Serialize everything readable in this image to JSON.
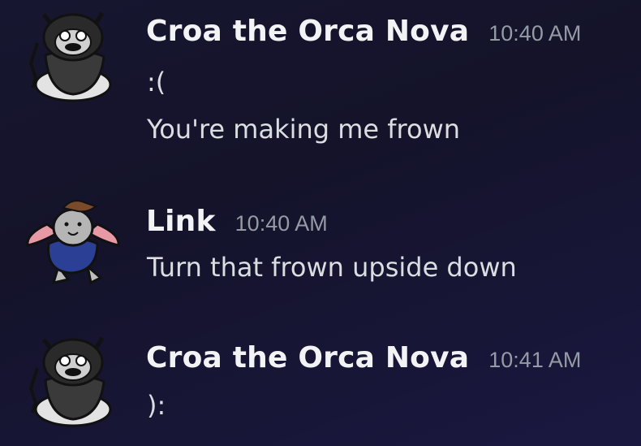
{
  "messages": [
    {
      "author": "Croa the Orca Nova",
      "time": "10:40 AM",
      "avatar_icon": "orca-avatar-icon",
      "lines": [
        ":(",
        "You're making me frown"
      ]
    },
    {
      "author": "Link",
      "time": "10:40 AM",
      "avatar_icon": "bunny-avatar-icon",
      "lines": [
        "Turn that frown upside down"
      ]
    },
    {
      "author": "Croa the Orca Nova",
      "time": "10:41 AM",
      "avatar_icon": "orca-avatar-icon",
      "lines": [
        "):"
      ]
    }
  ],
  "colors": {
    "background": "#15142d",
    "author": "#f2f3f5",
    "timestamp": "#949ba4",
    "message_text": "#dbdee1"
  }
}
